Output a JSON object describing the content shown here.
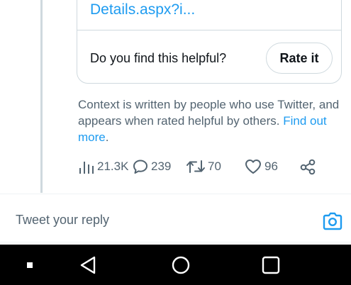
{
  "note_card": {
    "link_text": "Details.aspx?i...",
    "helpful_question": "Do you find this helpful?",
    "rate_button_label": "Rate it"
  },
  "context": {
    "text": "Context is written by people who use Twitter, and appears when rated helpful by others.",
    "link_text": "Find out more",
    "link_suffix": "."
  },
  "actions": {
    "views_count": "21.3K",
    "replies_count": "239",
    "retweets_count": "70",
    "likes_count": "96"
  },
  "reply": {
    "placeholder": "Tweet your reply"
  },
  "icons": {
    "views": "bar-chart-icon",
    "reply": "speech-bubble-icon",
    "retweet": "retweet-icon",
    "like": "heart-icon",
    "share": "share-nodes-icon",
    "camera": "camera-icon",
    "nav_recents": "square-dot-icon",
    "nav_back": "triangle-back-icon",
    "nav_home": "circle-home-icon",
    "nav_overview": "square-overview-icon"
  },
  "colors": {
    "accent": "#1d9bf0",
    "text_primary": "#0f1419",
    "text_secondary": "#536471",
    "border": "#cfd9de",
    "nav_background": "#000000"
  }
}
